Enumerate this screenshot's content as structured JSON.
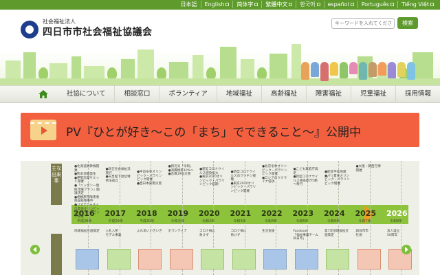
{
  "languages": [
    {
      "label": "日本語",
      "external": false
    },
    {
      "label": "English",
      "external": true
    },
    {
      "label": "简体字",
      "external": true
    },
    {
      "label": "繁體中文",
      "external": true
    },
    {
      "label": "한국어",
      "external": true
    },
    {
      "label": "español",
      "external": true
    },
    {
      "label": "Português",
      "external": true
    },
    {
      "label": "Tiếng Việt",
      "external": true
    }
  ],
  "header": {
    "org_sub": "社会福祉法人",
    "org_name": "四日市市社会福祉協議会",
    "search_placeholder": "キーワードを入れてください",
    "search_button": "検索"
  },
  "nav": {
    "home_icon": "house-icon",
    "items": [
      "社協について",
      "相談窓口",
      "ボランティア",
      "地域福祉",
      "高齢福祉",
      "障害福祉",
      "児童福祉",
      "採用情報"
    ]
  },
  "banner": {
    "text": "PV『ひとが好き～この「まち」でできること～』公開中",
    "icon": "film-play-icon"
  },
  "history": {
    "label_top": "主な出来事",
    "label_bottom": "",
    "years": [
      {
        "year": "2016",
        "era": "平成28年"
      },
      {
        "year": "2017",
        "era": "平成29年"
      },
      {
        "year": "2018",
        "era": "平成30年"
      },
      {
        "year": "2019",
        "era": "令和元年"
      },
      {
        "year": "2020",
        "era": "令和2年"
      },
      {
        "year": "2021",
        "era": "令和3年"
      },
      {
        "year": "2022",
        "era": "令和4年"
      },
      {
        "year": "2023",
        "era": "令和5年"
      },
      {
        "year": "2024",
        "era": "令和6年"
      },
      {
        "year": "2025",
        "era": "令和7年"
      },
      {
        "year": "2026",
        "era": "令和8年"
      }
    ],
    "notes_top": [
      "●北海道新幹線開業\n●熊本地震発生\n●伊勢志摩サミット開催\n●「ニッポン一億総活躍プラン」閣議決定\n●相模原市障害者施設殺傷事件\n●リオデジャネイロ夏季オリンピック・パラリンピック開催",
      "●改正社会福祉法施行\n●天皇陛下退位特例法成立",
      "●平昌冬季オリンピック・パラリンピック開催\n●西日本豪雨災害",
      "●新元号「令和」\n●消費税率10%へ\n●台風19号災害",
      "●新型コロナウイルス感染拡大\n●東京2020オリンピック・パラリンピック延期",
      "●新型コロナウイルスのワクチン接種\n●東京2020オリンピック・パラリンピック開催",
      "●北京冬季オリンピック・パラリンピック開催\n●ロシアのウクライナ侵攻",
      "●こども家庭庁発足\n●新型コロナウイルス感染症が5類へ移行",
      "●能登半島地震\n●パリ夏季オリンピック・パラリンピック開催",
      "●大阪・関西万博開催"
    ],
    "notes_bottom": [
      "地域福祉計画策定",
      "入札入所\nモデル事業",
      "ふれあいいきいき",
      "ボランティア",
      "コロナ禍に\n負けず",
      "コロナ禍に\n負けず",
      "生活支援",
      "Facebook\n「福祉事業チーム四日市」",
      "第7次地域福祉計画策定",
      "四日市市\n社協",
      "法人設立\n50周年"
    ]
  }
}
